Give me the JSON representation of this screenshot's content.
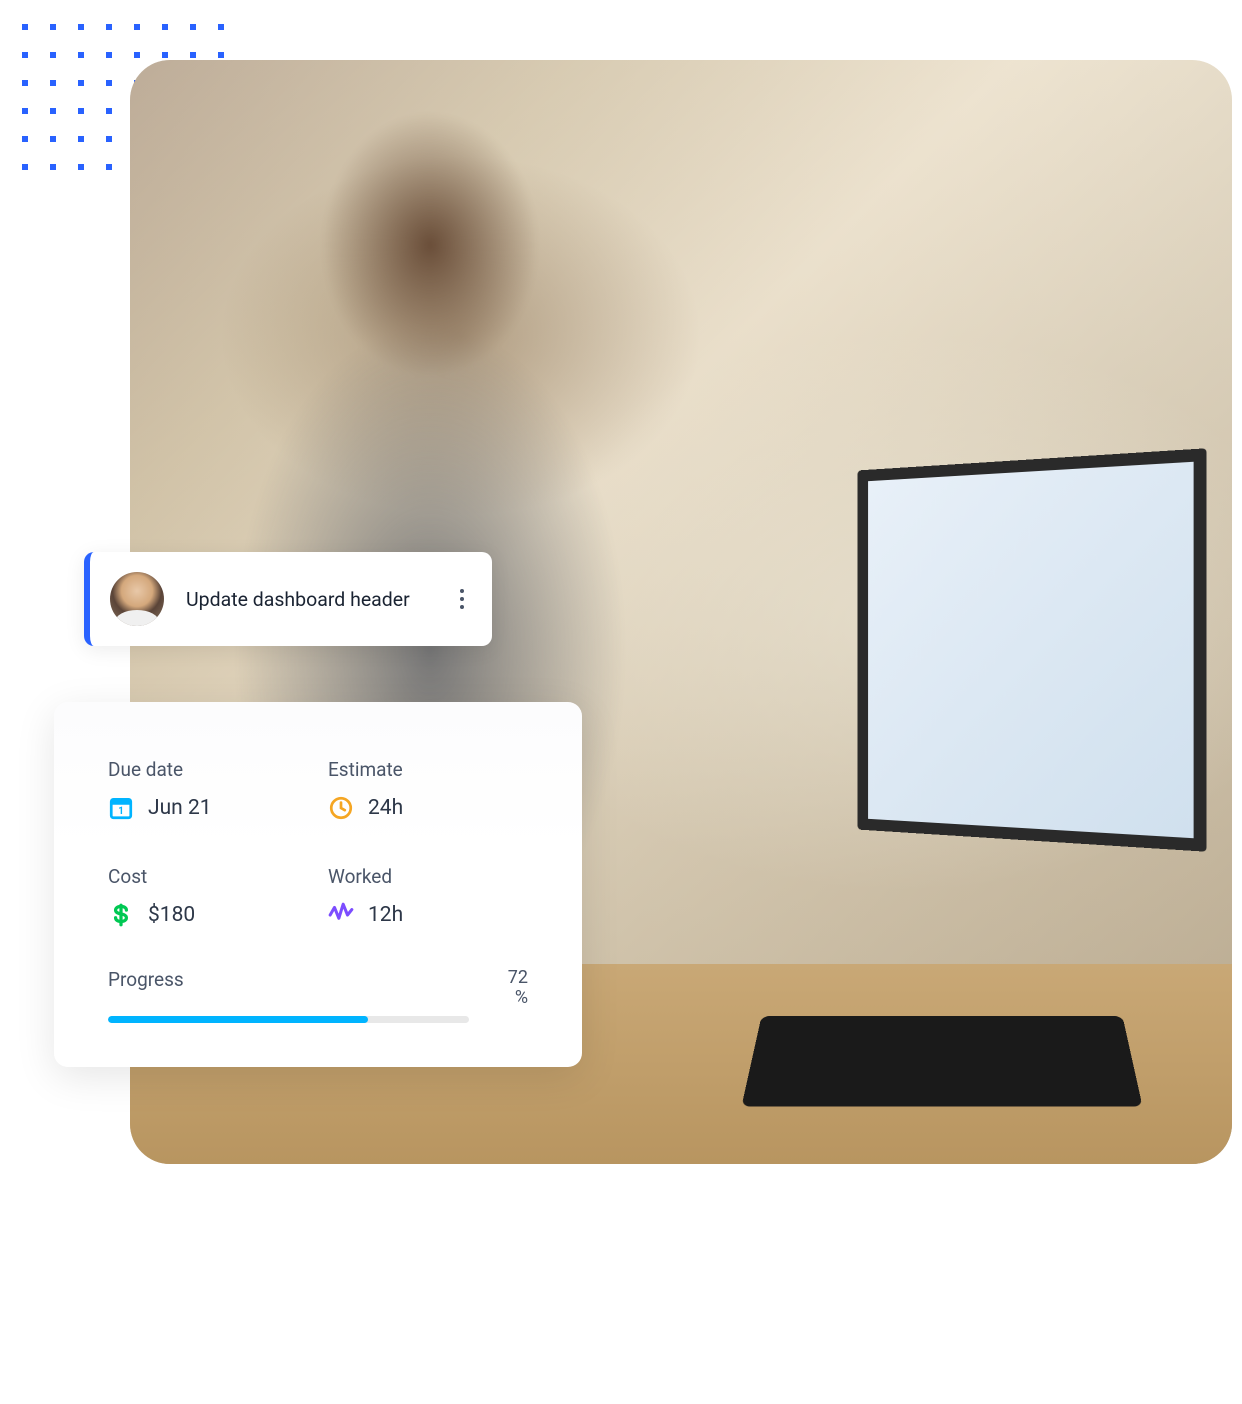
{
  "task": {
    "title": "Update dashboard header"
  },
  "details": {
    "due_date": {
      "label": "Due date",
      "value": "Jun 21"
    },
    "estimate": {
      "label": "Estimate",
      "value": "24h"
    },
    "cost": {
      "label": "Cost",
      "value": "$180"
    },
    "worked": {
      "label": "Worked",
      "value": "12h"
    },
    "progress": {
      "label": "Progress",
      "value": 72,
      "display": "72",
      "unit": "%"
    }
  },
  "colors": {
    "accent": "#2962FF",
    "calendar_icon": "#00B4FF",
    "clock_icon": "#F5A623",
    "dollar_icon": "#00C853",
    "activity_icon": "#7C4DFF",
    "progress_fill": "#00B4FF"
  }
}
